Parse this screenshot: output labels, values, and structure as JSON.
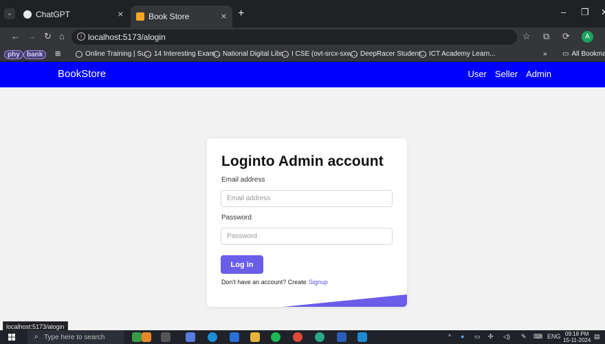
{
  "browser": {
    "tabs": [
      {
        "label": "ChatGPT",
        "active": false
      },
      {
        "label": "Book Store",
        "active": true
      }
    ],
    "address": "localhost:5173/alogin",
    "bookmarks": [
      {
        "label": "phy",
        "type": "pill"
      },
      {
        "label": "bank",
        "type": "pill"
      },
      {
        "label": "Online Training | Su..."
      },
      {
        "label": "14 Interesting Exam..."
      },
      {
        "label": "National Digital Libr..."
      },
      {
        "label": "I CSE (ovt-srcx-sxw..."
      },
      {
        "label": "DeepRacer Student..."
      },
      {
        "label": "ICT Academy Learn..."
      },
      {
        "label": "All Bookmarks"
      }
    ],
    "profile_initial": "A",
    "status_url": "localhost:5173/alogin"
  },
  "app": {
    "brand": "BookStore",
    "nav": [
      "User",
      "Seller",
      "Admin"
    ],
    "accent": "#0000ff"
  },
  "login": {
    "title": "Loginto Admin account",
    "email_label": "Email address",
    "email_placeholder": "Email address",
    "password_label": "Password",
    "password_placeholder": "Password",
    "submit_label": "Log in",
    "signup_prompt": "Don't have an account? Create",
    "signup_link": "Signup",
    "button_color": "#6a5de8"
  },
  "taskbar": {
    "search_placeholder": "Type here to search",
    "language": "ENG",
    "time": "09:18 PM",
    "date": "15-11-2024"
  }
}
